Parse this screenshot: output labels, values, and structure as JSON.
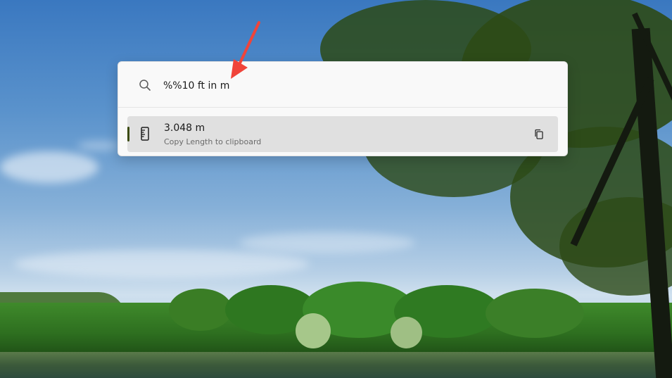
{
  "launcher": {
    "query": "%%10 ft in m",
    "results": [
      {
        "title": "3.048 m",
        "subtitle": "Copy Length to clipboard",
        "icon": "ruler-icon",
        "action_icon": "copy-icon"
      }
    ]
  },
  "colors": {
    "accent": "#3b4a10",
    "annotation_arrow": "#f0443a"
  }
}
